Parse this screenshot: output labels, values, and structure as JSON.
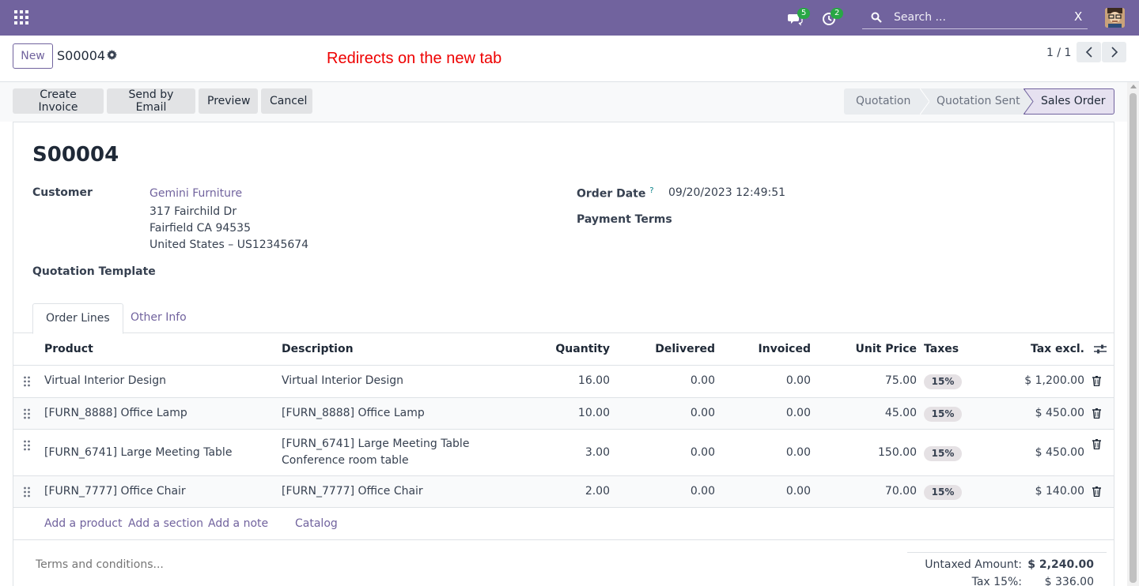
{
  "navbar": {
    "messages_count": "5",
    "activities_count": "2",
    "search_placeholder": "Search ...",
    "search_clear": "X",
    "brand_color": "#71639e"
  },
  "control_panel": {
    "new_label": "New",
    "record_name": "S00004",
    "annotation": "Redirects on the new tab",
    "pager_value": "1 / 1"
  },
  "actions": {
    "create_invoice": "Create Invoice",
    "send_email": "Send by Email",
    "preview": "Preview",
    "cancel": "Cancel"
  },
  "stages": [
    {
      "label": "Quotation",
      "active": false
    },
    {
      "label": "Quotation Sent",
      "active": false
    },
    {
      "label": "Sales Order",
      "active": true
    }
  ],
  "form": {
    "title": "S00004",
    "customer_label": "Customer",
    "customer_name": "Gemini Furniture",
    "address_line1": "317 Fairchild Dr",
    "address_line2": "Fairfield CA 94535",
    "address_line3": "United States – US12345674",
    "template_label": "Quotation Template",
    "order_date_label": "Order Date",
    "order_date_help": "?",
    "order_date_value": "09/20/2023 12:49:51",
    "payment_terms_label": "Payment Terms"
  },
  "tabs": {
    "order_lines": "Order Lines",
    "other_info": "Other Info"
  },
  "table": {
    "headers": {
      "product": "Product",
      "description": "Description",
      "quantity": "Quantity",
      "delivered": "Delivered",
      "invoiced": "Invoiced",
      "unit_price": "Unit Price",
      "taxes": "Taxes",
      "tax_excl": "Tax excl."
    },
    "rows": [
      {
        "product": "Virtual Interior Design",
        "description": "Virtual Interior Design",
        "description2": "",
        "quantity": "16.00",
        "delivered": "0.00",
        "invoiced": "0.00",
        "unit_price": "75.00",
        "tax": "15%",
        "subtotal": "$ 1,200.00"
      },
      {
        "product": "[FURN_8888] Office Lamp",
        "description": "[FURN_8888] Office Lamp",
        "description2": "",
        "quantity": "10.00",
        "delivered": "0.00",
        "invoiced": "0.00",
        "unit_price": "45.00",
        "tax": "15%",
        "subtotal": "$ 450.00"
      },
      {
        "product": "[FURN_6741] Large Meeting Table",
        "description": "[FURN_6741] Large Meeting Table",
        "description2": "Conference room table",
        "quantity": "3.00",
        "delivered": "0.00",
        "invoiced": "0.00",
        "unit_price": "150.00",
        "tax": "15%",
        "subtotal": "$ 450.00"
      },
      {
        "product": "[FURN_7777] Office Chair",
        "description": "[FURN_7777] Office Chair",
        "description2": "",
        "quantity": "2.00",
        "delivered": "0.00",
        "invoiced": "0.00",
        "unit_price": "70.00",
        "tax": "15%",
        "subtotal": "$ 140.00"
      }
    ],
    "add_product": "Add a product",
    "add_section": "Add a section",
    "add_note": "Add a note",
    "catalog": "Catalog"
  },
  "footer": {
    "terms_placeholder": "Terms and conditions...",
    "untaxed_label": "Untaxed Amount:",
    "untaxed_value": "$ 2,240.00",
    "tax_label": "Tax 15%:",
    "tax_value": "$ 336.00"
  }
}
